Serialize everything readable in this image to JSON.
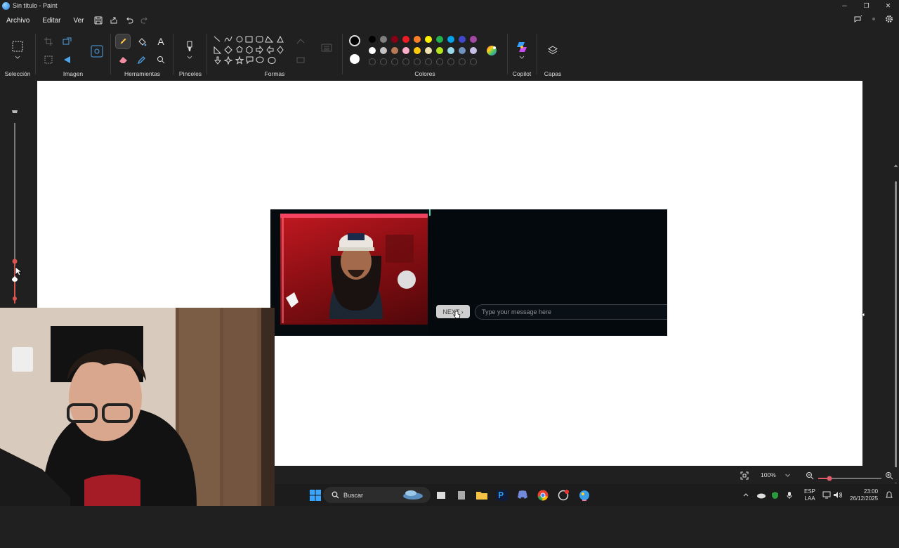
{
  "window": {
    "title": "Sin título - Paint",
    "minimize": "─",
    "restore": "❐",
    "close": "✕"
  },
  "menu": {
    "items": [
      "Archivo",
      "Editar",
      "Ver"
    ]
  },
  "ribbon": {
    "groups": {
      "seleccion": "Selección",
      "imagen": "Imagen",
      "herramientas": "Herramientas",
      "pinceles": "Pinceles",
      "formas": "Formas",
      "colores": "Colores",
      "copilot": "Copilot",
      "capas": "Capas"
    },
    "text_tool_glyph": "A"
  },
  "colors": {
    "row1": [
      "#000000",
      "#7f7f7f",
      "#880015",
      "#ed1c24",
      "#ff7f27",
      "#fff200",
      "#22b14c",
      "#00a2e8",
      "#3f48cc",
      "#a349a4"
    ],
    "row2": [
      "#ffffff",
      "#c3c3c3",
      "#b97a57",
      "#ffaec9",
      "#ffc90e",
      "#efe4b0",
      "#b5e61d",
      "#99d9ea",
      "#7092be",
      "#c8bfe7"
    ],
    "primary": "#000000",
    "secondary": "#ffffff"
  },
  "pasted_screenshot": {
    "next_button": "NEXT ›",
    "message_placeholder": "Type your message here"
  },
  "statusbar": {
    "zoom": "100%"
  },
  "taskbar": {
    "search": "Buscar",
    "lang_top": "ESP",
    "lang_bottom": "LAA",
    "time": "23:00",
    "date": "26/12/2025"
  }
}
